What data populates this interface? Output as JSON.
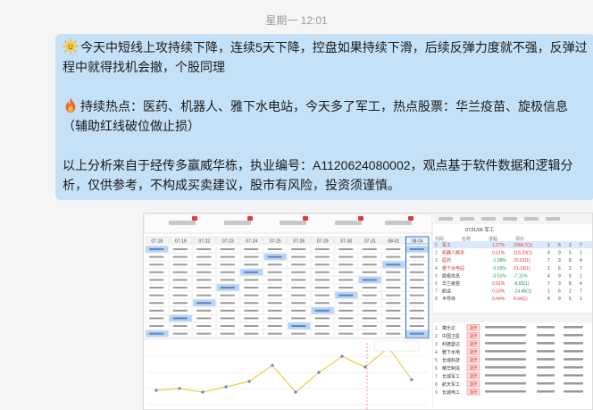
{
  "timestamp": "星期一 12:01",
  "message": {
    "p1_lead_icon": "sun-face-icon",
    "p1": "今天中短线上攻持续下降，连续5天下降，控盘如果持续下滑，后续反弹力度就不强，反弹过程中就得找机会撤，个股同理",
    "p2_lead_icon": "fire-icon",
    "p2": "持续热点：医药、机器人、雅下水电站，今天多了军工，热点股票：华兰疫苗、旋极信息（辅助红线破位做止损）",
    "p3": "以上分析来自于经传多赢威华栋，执业编号：A1120624080002，观点基于软件数据和逻辑分析，仅供参考，不构成买卖建议，股市有风险，投资须谨慎。"
  },
  "colors": {
    "bubble": "#c5e1f7",
    "background": "#f5f5f5",
    "up": "#e03a3a",
    "down": "#1a9a4a",
    "selected": "#2a6fd6"
  },
  "screenshot": {
    "date_columns": [
      "07-18",
      "07-19",
      "07-22",
      "07-23",
      "07-24",
      "07-25",
      "07-26",
      "07-29",
      "07-30",
      "07-31",
      "08-01",
      "08-04"
    ],
    "right_header": "0731/06 军工",
    "right_col_headers": [
      "代码",
      "名称",
      "涨幅",
      "现价"
    ],
    "right_rows": [
      {
        "name": "军工",
        "pct": "1.27%",
        "value": "2068.7(1)"
      },
      {
        "name": "机器人概念",
        "pct": "0.61%",
        "value": "115.33(1)"
      },
      {
        "name": "医药",
        "pct": "-1.09%",
        "value": "20.52(1)"
      },
      {
        "name": "雅下水电站",
        "pct": "-0.53%",
        "value": "21.19(1)"
      },
      {
        "name": "旋极信息",
        "pct": "-0.51%",
        "value": "-7.11%"
      },
      {
        "name": "华兰疫苗",
        "pct": "0.91%",
        "value": "-8.83(1)"
      },
      {
        "name": "航运",
        "pct": "0.33%",
        "value": "-24.46(1)"
      },
      {
        "name": "半导体",
        "pct": "0.44%",
        "value": "8.94(1)"
      }
    ],
    "bottom_rows": [
      {
        "name": "菜乐达",
        "tag": "涨停"
      },
      {
        "name": "中国卫星",
        "tag": "涨停"
      },
      {
        "name": "利德曼达",
        "tag": "涨停"
      },
      {
        "name": "雅下水电",
        "tag": "涨停"
      },
      {
        "name": "长城科技",
        "tag": "涨停"
      },
      {
        "name": "精华制造",
        "tag": "涨停"
      },
      {
        "name": "长城军工",
        "tag": "涨停"
      },
      {
        "name": "航天军工",
        "tag": "涨停"
      },
      {
        "name": "长城电工",
        "tag": "涨停"
      }
    ]
  }
}
